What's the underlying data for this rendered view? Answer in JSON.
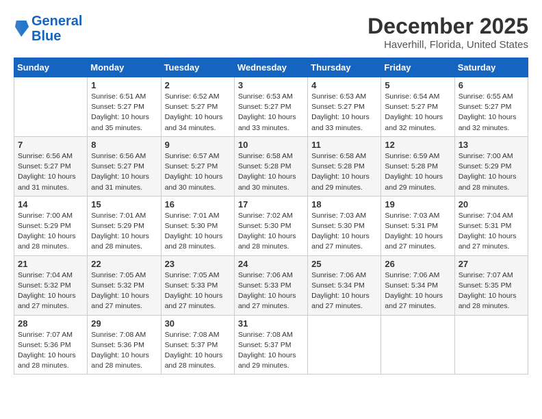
{
  "header": {
    "logo_line1": "General",
    "logo_line2": "Blue",
    "title": "December 2025",
    "subtitle": "Haverhill, Florida, United States"
  },
  "calendar": {
    "days_of_week": [
      "Sunday",
      "Monday",
      "Tuesday",
      "Wednesday",
      "Thursday",
      "Friday",
      "Saturday"
    ],
    "weeks": [
      [
        {
          "num": "",
          "sunrise": "",
          "sunset": "",
          "daylight": "",
          "empty": true
        },
        {
          "num": "1",
          "sunrise": "Sunrise: 6:51 AM",
          "sunset": "Sunset: 5:27 PM",
          "daylight": "Daylight: 10 hours and 35 minutes."
        },
        {
          "num": "2",
          "sunrise": "Sunrise: 6:52 AM",
          "sunset": "Sunset: 5:27 PM",
          "daylight": "Daylight: 10 hours and 34 minutes."
        },
        {
          "num": "3",
          "sunrise": "Sunrise: 6:53 AM",
          "sunset": "Sunset: 5:27 PM",
          "daylight": "Daylight: 10 hours and 33 minutes."
        },
        {
          "num": "4",
          "sunrise": "Sunrise: 6:53 AM",
          "sunset": "Sunset: 5:27 PM",
          "daylight": "Daylight: 10 hours and 33 minutes."
        },
        {
          "num": "5",
          "sunrise": "Sunrise: 6:54 AM",
          "sunset": "Sunset: 5:27 PM",
          "daylight": "Daylight: 10 hours and 32 minutes."
        },
        {
          "num": "6",
          "sunrise": "Sunrise: 6:55 AM",
          "sunset": "Sunset: 5:27 PM",
          "daylight": "Daylight: 10 hours and 32 minutes."
        }
      ],
      [
        {
          "num": "7",
          "sunrise": "Sunrise: 6:56 AM",
          "sunset": "Sunset: 5:27 PM",
          "daylight": "Daylight: 10 hours and 31 minutes."
        },
        {
          "num": "8",
          "sunrise": "Sunrise: 6:56 AM",
          "sunset": "Sunset: 5:27 PM",
          "daylight": "Daylight: 10 hours and 31 minutes."
        },
        {
          "num": "9",
          "sunrise": "Sunrise: 6:57 AM",
          "sunset": "Sunset: 5:27 PM",
          "daylight": "Daylight: 10 hours and 30 minutes."
        },
        {
          "num": "10",
          "sunrise": "Sunrise: 6:58 AM",
          "sunset": "Sunset: 5:28 PM",
          "daylight": "Daylight: 10 hours and 30 minutes."
        },
        {
          "num": "11",
          "sunrise": "Sunrise: 6:58 AM",
          "sunset": "Sunset: 5:28 PM",
          "daylight": "Daylight: 10 hours and 29 minutes."
        },
        {
          "num": "12",
          "sunrise": "Sunrise: 6:59 AM",
          "sunset": "Sunset: 5:28 PM",
          "daylight": "Daylight: 10 hours and 29 minutes."
        },
        {
          "num": "13",
          "sunrise": "Sunrise: 7:00 AM",
          "sunset": "Sunset: 5:29 PM",
          "daylight": "Daylight: 10 hours and 28 minutes."
        }
      ],
      [
        {
          "num": "14",
          "sunrise": "Sunrise: 7:00 AM",
          "sunset": "Sunset: 5:29 PM",
          "daylight": "Daylight: 10 hours and 28 minutes."
        },
        {
          "num": "15",
          "sunrise": "Sunrise: 7:01 AM",
          "sunset": "Sunset: 5:29 PM",
          "daylight": "Daylight: 10 hours and 28 minutes."
        },
        {
          "num": "16",
          "sunrise": "Sunrise: 7:01 AM",
          "sunset": "Sunset: 5:30 PM",
          "daylight": "Daylight: 10 hours and 28 minutes."
        },
        {
          "num": "17",
          "sunrise": "Sunrise: 7:02 AM",
          "sunset": "Sunset: 5:30 PM",
          "daylight": "Daylight: 10 hours and 28 minutes."
        },
        {
          "num": "18",
          "sunrise": "Sunrise: 7:03 AM",
          "sunset": "Sunset: 5:30 PM",
          "daylight": "Daylight: 10 hours and 27 minutes."
        },
        {
          "num": "19",
          "sunrise": "Sunrise: 7:03 AM",
          "sunset": "Sunset: 5:31 PM",
          "daylight": "Daylight: 10 hours and 27 minutes."
        },
        {
          "num": "20",
          "sunrise": "Sunrise: 7:04 AM",
          "sunset": "Sunset: 5:31 PM",
          "daylight": "Daylight: 10 hours and 27 minutes."
        }
      ],
      [
        {
          "num": "21",
          "sunrise": "Sunrise: 7:04 AM",
          "sunset": "Sunset: 5:32 PM",
          "daylight": "Daylight: 10 hours and 27 minutes."
        },
        {
          "num": "22",
          "sunrise": "Sunrise: 7:05 AM",
          "sunset": "Sunset: 5:32 PM",
          "daylight": "Daylight: 10 hours and 27 minutes."
        },
        {
          "num": "23",
          "sunrise": "Sunrise: 7:05 AM",
          "sunset": "Sunset: 5:33 PM",
          "daylight": "Daylight: 10 hours and 27 minutes."
        },
        {
          "num": "24",
          "sunrise": "Sunrise: 7:06 AM",
          "sunset": "Sunset: 5:33 PM",
          "daylight": "Daylight: 10 hours and 27 minutes."
        },
        {
          "num": "25",
          "sunrise": "Sunrise: 7:06 AM",
          "sunset": "Sunset: 5:34 PM",
          "daylight": "Daylight: 10 hours and 27 minutes."
        },
        {
          "num": "26",
          "sunrise": "Sunrise: 7:06 AM",
          "sunset": "Sunset: 5:34 PM",
          "daylight": "Daylight: 10 hours and 27 minutes."
        },
        {
          "num": "27",
          "sunrise": "Sunrise: 7:07 AM",
          "sunset": "Sunset: 5:35 PM",
          "daylight": "Daylight: 10 hours and 28 minutes."
        }
      ],
      [
        {
          "num": "28",
          "sunrise": "Sunrise: 7:07 AM",
          "sunset": "Sunset: 5:36 PM",
          "daylight": "Daylight: 10 hours and 28 minutes."
        },
        {
          "num": "29",
          "sunrise": "Sunrise: 7:08 AM",
          "sunset": "Sunset: 5:36 PM",
          "daylight": "Daylight: 10 hours and 28 minutes."
        },
        {
          "num": "30",
          "sunrise": "Sunrise: 7:08 AM",
          "sunset": "Sunset: 5:37 PM",
          "daylight": "Daylight: 10 hours and 28 minutes."
        },
        {
          "num": "31",
          "sunrise": "Sunrise: 7:08 AM",
          "sunset": "Sunset: 5:37 PM",
          "daylight": "Daylight: 10 hours and 29 minutes."
        },
        {
          "num": "",
          "sunrise": "",
          "sunset": "",
          "daylight": "",
          "empty": true
        },
        {
          "num": "",
          "sunrise": "",
          "sunset": "",
          "daylight": "",
          "empty": true
        },
        {
          "num": "",
          "sunrise": "",
          "sunset": "",
          "daylight": "",
          "empty": true
        }
      ]
    ]
  }
}
